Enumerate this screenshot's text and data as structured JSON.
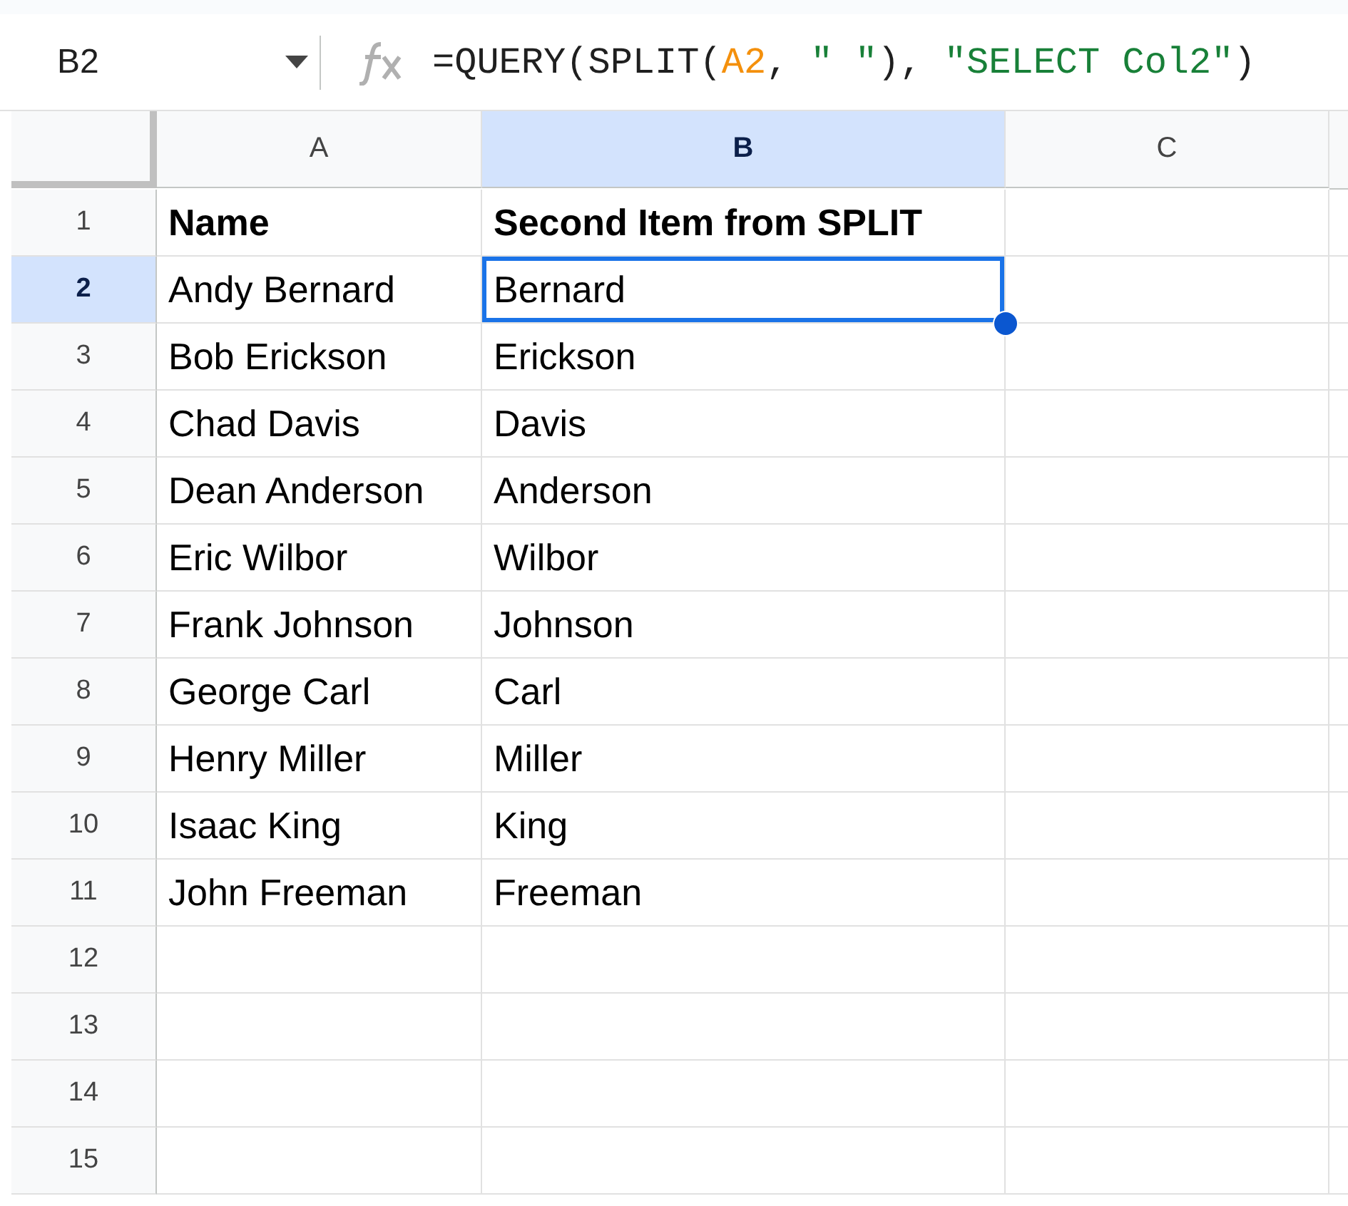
{
  "name_box": "B2",
  "formula": [
    {
      "kind": "plain",
      "text": "=QUERY(SPLIT("
    },
    {
      "kind": "ref",
      "text": "A2"
    },
    {
      "kind": "plain",
      "text": ", "
    },
    {
      "kind": "string",
      "text": "\" \""
    },
    {
      "kind": "plain",
      "text": "), "
    },
    {
      "kind": "string",
      "text": "\"SELECT Col2\""
    },
    {
      "kind": "plain",
      "text": ")"
    }
  ],
  "columns": [
    {
      "label": "A",
      "selected": false
    },
    {
      "label": "B",
      "selected": true
    },
    {
      "label": "C",
      "selected": false
    }
  ],
  "rows": [
    {
      "number": "1",
      "selected": false,
      "kind": "header",
      "cells": [
        "Name",
        "Second Item from SPLIT"
      ]
    },
    {
      "number": "2",
      "selected": true,
      "kind": "data",
      "cells": [
        "Andy Bernard",
        "Bernard"
      ]
    },
    {
      "number": "3",
      "selected": false,
      "kind": "data",
      "cells": [
        "Bob Erickson",
        "Erickson"
      ]
    },
    {
      "number": "4",
      "selected": false,
      "kind": "data",
      "cells": [
        "Chad Davis",
        "Davis"
      ]
    },
    {
      "number": "5",
      "selected": false,
      "kind": "data",
      "cells": [
        "Dean Anderson",
        "Anderson"
      ]
    },
    {
      "number": "6",
      "selected": false,
      "kind": "data",
      "cells": [
        "Eric Wilbor",
        "Wilbor"
      ]
    },
    {
      "number": "7",
      "selected": false,
      "kind": "data",
      "cells": [
        "Frank Johnson",
        "Johnson"
      ]
    },
    {
      "number": "8",
      "selected": false,
      "kind": "data",
      "cells": [
        "George Carl",
        "Carl"
      ]
    },
    {
      "number": "9",
      "selected": false,
      "kind": "data",
      "cells": [
        "Henry Miller",
        "Miller"
      ]
    },
    {
      "number": "10",
      "selected": false,
      "kind": "data",
      "cells": [
        "Isaac King",
        "King"
      ]
    },
    {
      "number": "11",
      "selected": false,
      "kind": "data",
      "cells": [
        "John Freeman",
        "Freeman"
      ]
    },
    {
      "number": "12",
      "selected": false,
      "kind": "data"
    },
    {
      "number": "13",
      "selected": false,
      "kind": "data"
    },
    {
      "number": "14",
      "selected": false,
      "kind": "data"
    },
    {
      "number": "15",
      "selected": false,
      "kind": "data"
    }
  ]
}
